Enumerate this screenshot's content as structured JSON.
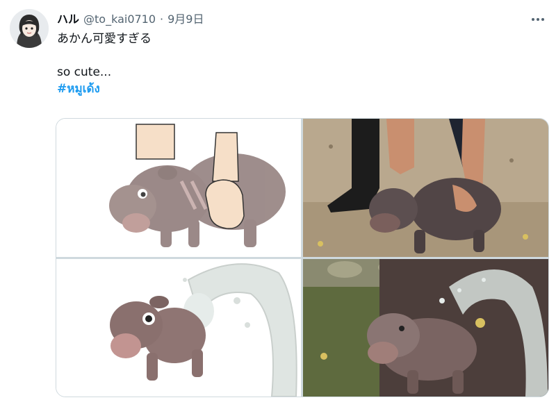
{
  "tweet": {
    "display_name": "ハル",
    "handle": "@to_kai0710",
    "separator": "·",
    "date": "9月9日",
    "text_line1": "あかん可愛すぎる",
    "text_line2": "so cute...",
    "hashtag": "#หมูเด้ง"
  },
  "icons": {
    "more": "more-horizontal-icon",
    "avatar": "anime-avatar"
  },
  "media": [
    {
      "kind": "cartoon",
      "subject": "baby-hippo-patted-drawing"
    },
    {
      "kind": "photo",
      "subject": "baby-hippo-held-by-keeper"
    },
    {
      "kind": "cartoon",
      "subject": "baby-hippo-splashed-drawing"
    },
    {
      "kind": "photo",
      "subject": "baby-hippo-sprayed-with-water"
    }
  ],
  "colors": {
    "text": "#0f1419",
    "secondary": "#536471",
    "hashtag": "#1d9bf0",
    "border": "#cfd9de"
  }
}
